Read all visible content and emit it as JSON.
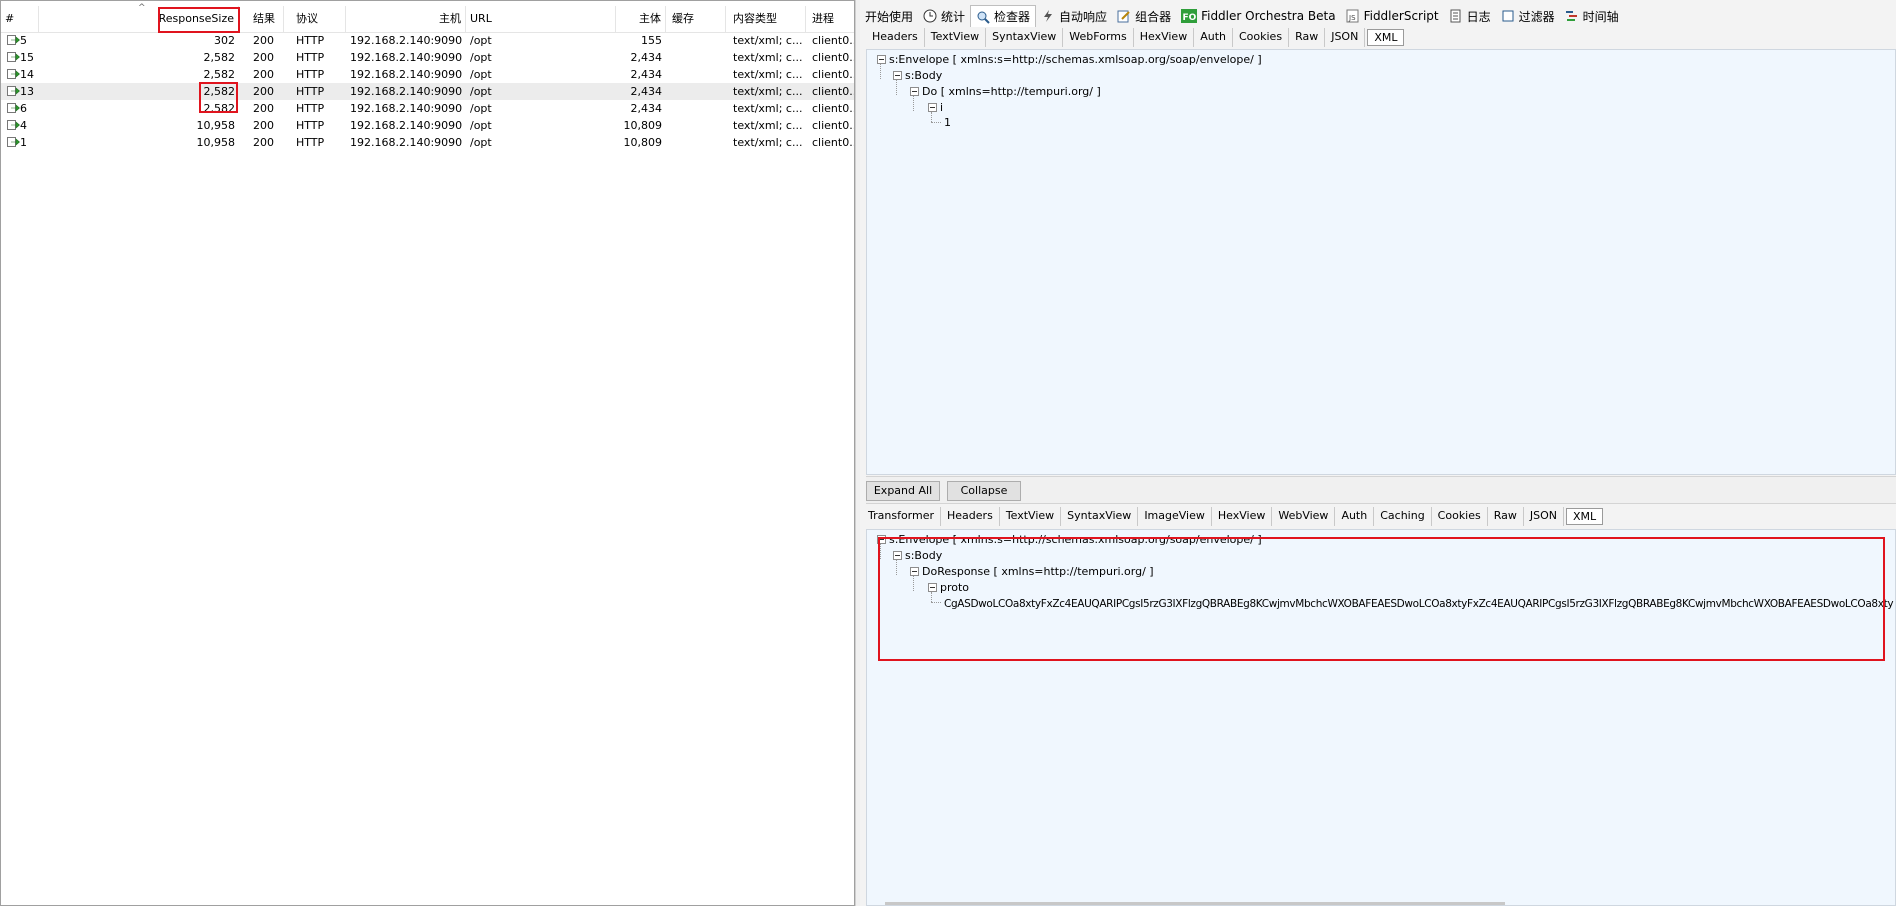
{
  "sessions": {
    "columns": [
      "#",
      "ResponseSize",
      "结果",
      "协议",
      "主机",
      "URL",
      "主体",
      "缓存",
      "内容类型",
      "进程"
    ],
    "rows": [
      {
        "num": "5",
        "size": "302",
        "result": "200",
        "protocol": "HTTP",
        "host": "192.168.2.140:9090",
        "url": "/opt",
        "body": "155",
        "cache": "",
        "content_type": "text/xml; c...",
        "process": "client0..."
      },
      {
        "num": "15",
        "size": "2,582",
        "result": "200",
        "protocol": "HTTP",
        "host": "192.168.2.140:9090",
        "url": "/opt",
        "body": "2,434",
        "cache": "",
        "content_type": "text/xml; c...",
        "process": "client0..."
      },
      {
        "num": "14",
        "size": "2,582",
        "result": "200",
        "protocol": "HTTP",
        "host": "192.168.2.140:9090",
        "url": "/opt",
        "body": "2,434",
        "cache": "",
        "content_type": "text/xml; c...",
        "process": "client0..."
      },
      {
        "num": "13",
        "size": "2,582",
        "result": "200",
        "protocol": "HTTP",
        "host": "192.168.2.140:9090",
        "url": "/opt",
        "body": "2,434",
        "cache": "",
        "content_type": "text/xml; c...",
        "process": "client0..."
      },
      {
        "num": "6",
        "size": "2,582",
        "result": "200",
        "protocol": "HTTP",
        "host": "192.168.2.140:9090",
        "url": "/opt",
        "body": "2,434",
        "cache": "",
        "content_type": "text/xml; c...",
        "process": "client0..."
      },
      {
        "num": "4",
        "size": "10,958",
        "result": "200",
        "protocol": "HTTP",
        "host": "192.168.2.140:9090",
        "url": "/opt",
        "body": "10,809",
        "cache": "",
        "content_type": "text/xml; c...",
        "process": "client0..."
      },
      {
        "num": "1",
        "size": "10,958",
        "result": "200",
        "protocol": "HTTP",
        "host": "192.168.2.140:9090",
        "url": "/opt",
        "body": "10,809",
        "cache": "",
        "content_type": "text/xml; c...",
        "process": "client0..."
      }
    ]
  },
  "main_tabs": [
    {
      "label": "开始使用",
      "icon": ""
    },
    {
      "label": "统计",
      "icon": "clock-icon"
    },
    {
      "label": "检查器",
      "icon": "inspect-icon"
    },
    {
      "label": "自动响应",
      "icon": "lightning-icon"
    },
    {
      "label": "组合器",
      "icon": "composer-icon"
    },
    {
      "label": "Fiddler Orchestra Beta",
      "icon": "fo-icon"
    },
    {
      "label": "FiddlerScript",
      "icon": "script-icon"
    },
    {
      "label": "日志",
      "icon": "log-icon"
    },
    {
      "label": "过滤器",
      "icon": "checkbox-icon"
    },
    {
      "label": "时间轴",
      "icon": "timeline-icon"
    }
  ],
  "request_tabs": [
    "Headers",
    "TextView",
    "SyntaxView",
    "WebForms",
    "HexView",
    "Auth",
    "Cookies",
    "Raw",
    "JSON",
    "XML"
  ],
  "request_tree": {
    "envelope": "s:Envelope [ xmlns:s=http://schemas.xmlsoap.org/soap/envelope/ ]",
    "body": "s:Body",
    "method": "Do [ xmlns=http://tempuri.org/ ]",
    "param": "i",
    "value": "1"
  },
  "buttons": {
    "expand": "Expand All",
    "collapse": "Collapse"
  },
  "response_tabs": [
    "Transformer",
    "Headers",
    "TextView",
    "SyntaxView",
    "ImageView",
    "HexView",
    "WebView",
    "Auth",
    "Caching",
    "Cookies",
    "Raw",
    "JSON",
    "XML"
  ],
  "response_tree": {
    "envelope": "s:Envelope [ xmlns:s=http://schemas.xmlsoap.org/soap/envelope/ ]",
    "body": "s:Body",
    "method": "DoResponse [ xmlns=http://tempuri.org/ ]",
    "param": "proto",
    "value": "CgASDwoLCOa8xtyFxZc4EAUQARIPCgsI5rzG3IXFlzgQBRABEg8KCwjmvMbchcWXOBAFEAESDwoLCOa8xtyFxZc4EAUQARIPCgsI5rzG3IXFlzgQBRABEg8KCwjmvMbchcWXOBAFEAESDwoLCOa8xty"
  },
  "colors": {
    "highlight": "#e0141e",
    "tree_bg": "#f0f7fe",
    "selected_row": "#ececec",
    "arrow_green": "#2e9a2e"
  }
}
